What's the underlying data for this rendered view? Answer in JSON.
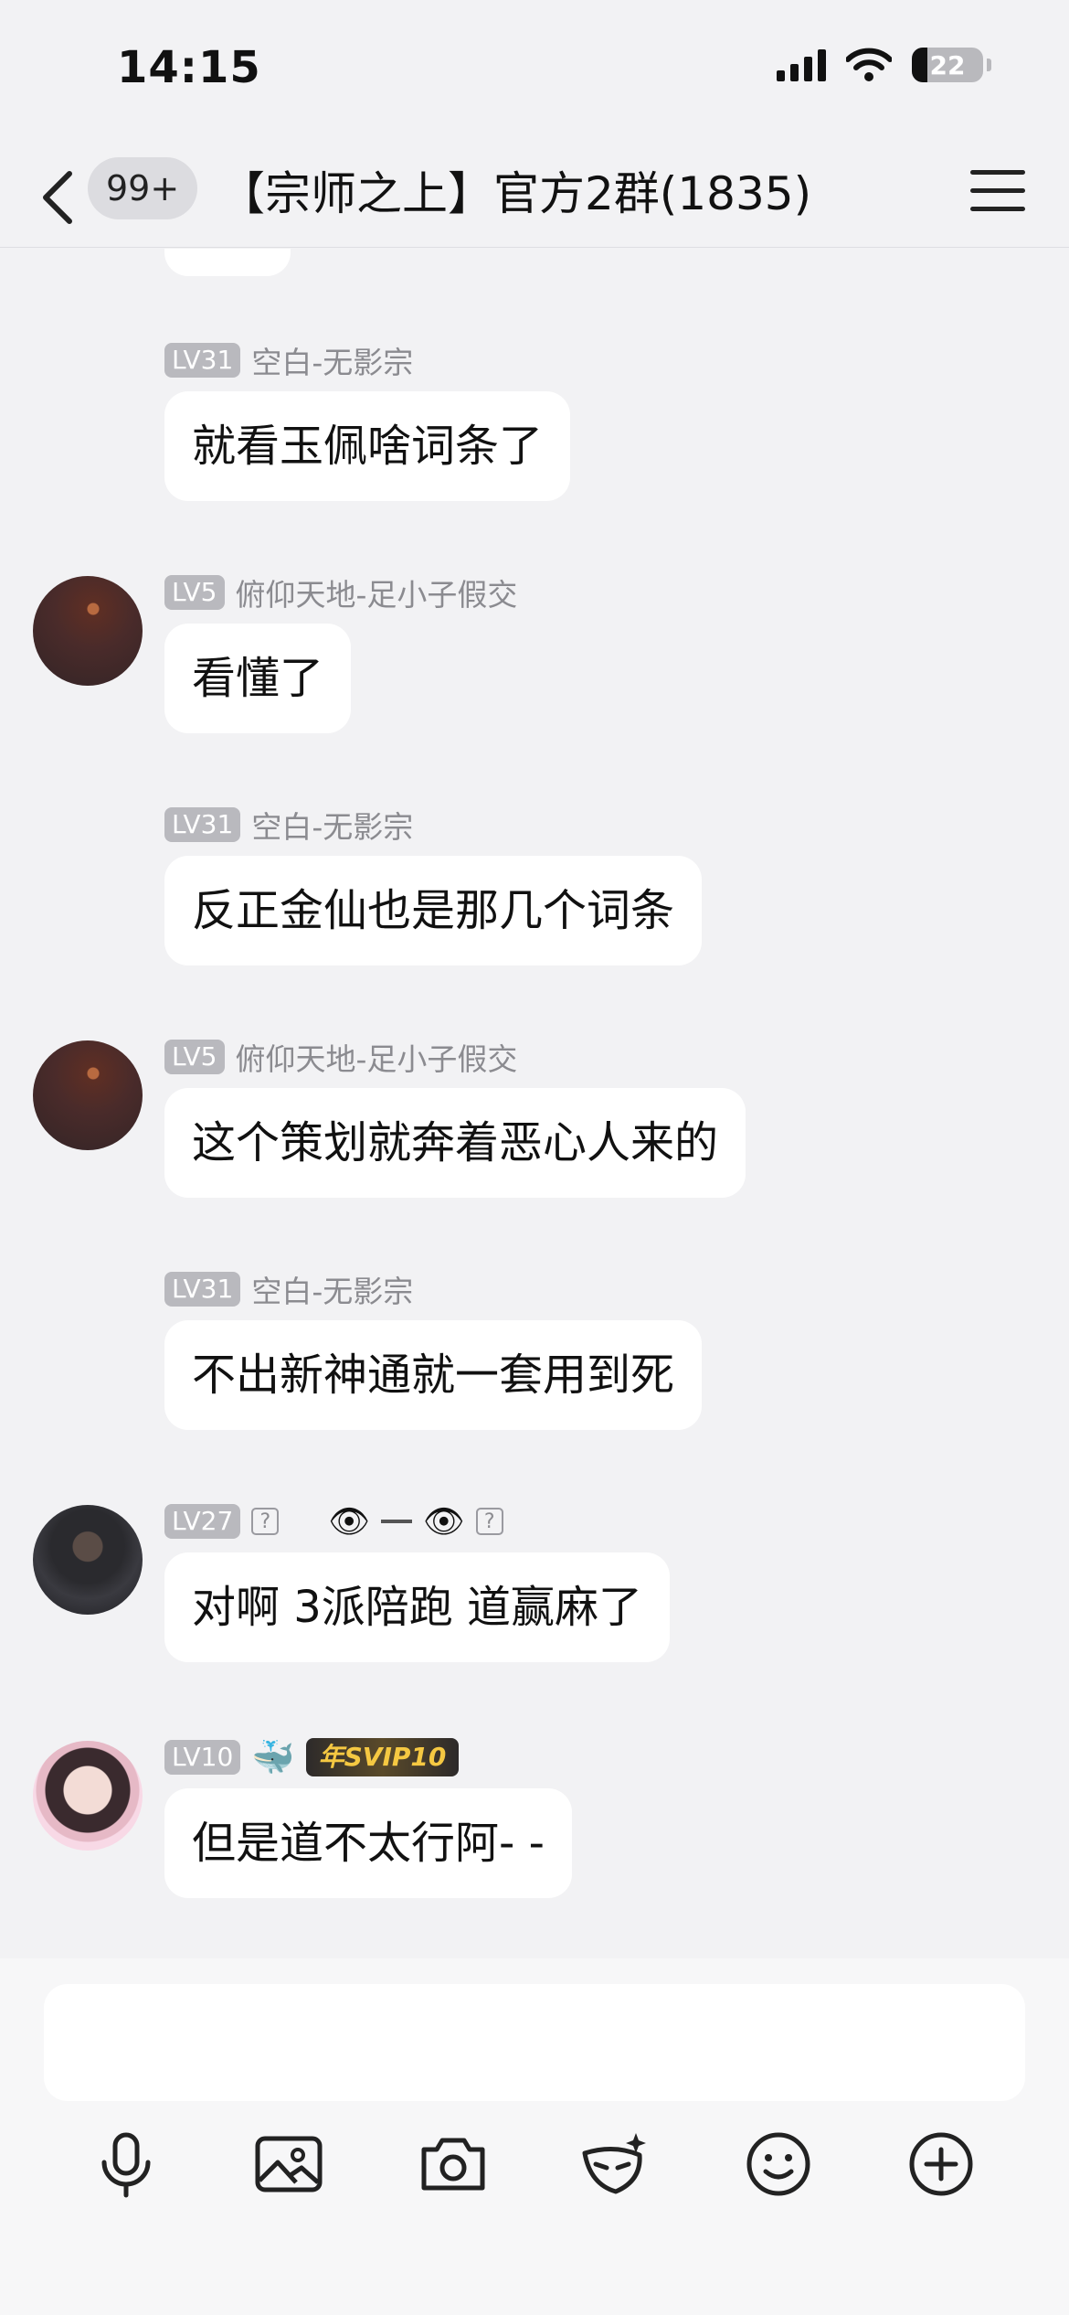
{
  "status_bar": {
    "time": "14:15",
    "battery_level": "22"
  },
  "nav": {
    "unread_count": "99+",
    "title": "【宗师之上】官方2群(1835)"
  },
  "messages": [
    {
      "level": "LV31",
      "sender": "空白-无影宗",
      "text": "就看玉佩啥词条了",
      "avatar": "none"
    },
    {
      "level": "LV5",
      "sender": "俯仰天地-足小子假交",
      "text": "看懂了",
      "avatar": "night-sky"
    },
    {
      "level": "LV31",
      "sender": "空白-无影宗",
      "text": "反正金仙也是那几个词条",
      "avatar": "none"
    },
    {
      "level": "LV5",
      "sender": "俯仰天地-足小子假交",
      "text": "这个策划就奔着恶心人来的",
      "avatar": "night-sky"
    },
    {
      "level": "LV31",
      "sender": "空白-无影宗",
      "text": "不出新神通就一套用到死",
      "avatar": "none"
    },
    {
      "level": "LV27",
      "sender": "?",
      "text": "对啊 3派陪跑  道赢麻了",
      "avatar": "gym-photo"
    },
    {
      "level": "LV10",
      "sender": "",
      "text": "但是道不太行阿- -",
      "avatar": "girl-photo",
      "badge": "年SVIP10"
    }
  ],
  "input": {
    "placeholder": ""
  },
  "toolbar": [
    "microphone-icon",
    "image-icon",
    "camera-icon",
    "mask-emoji-icon",
    "smiley-icon",
    "plus-icon"
  ]
}
